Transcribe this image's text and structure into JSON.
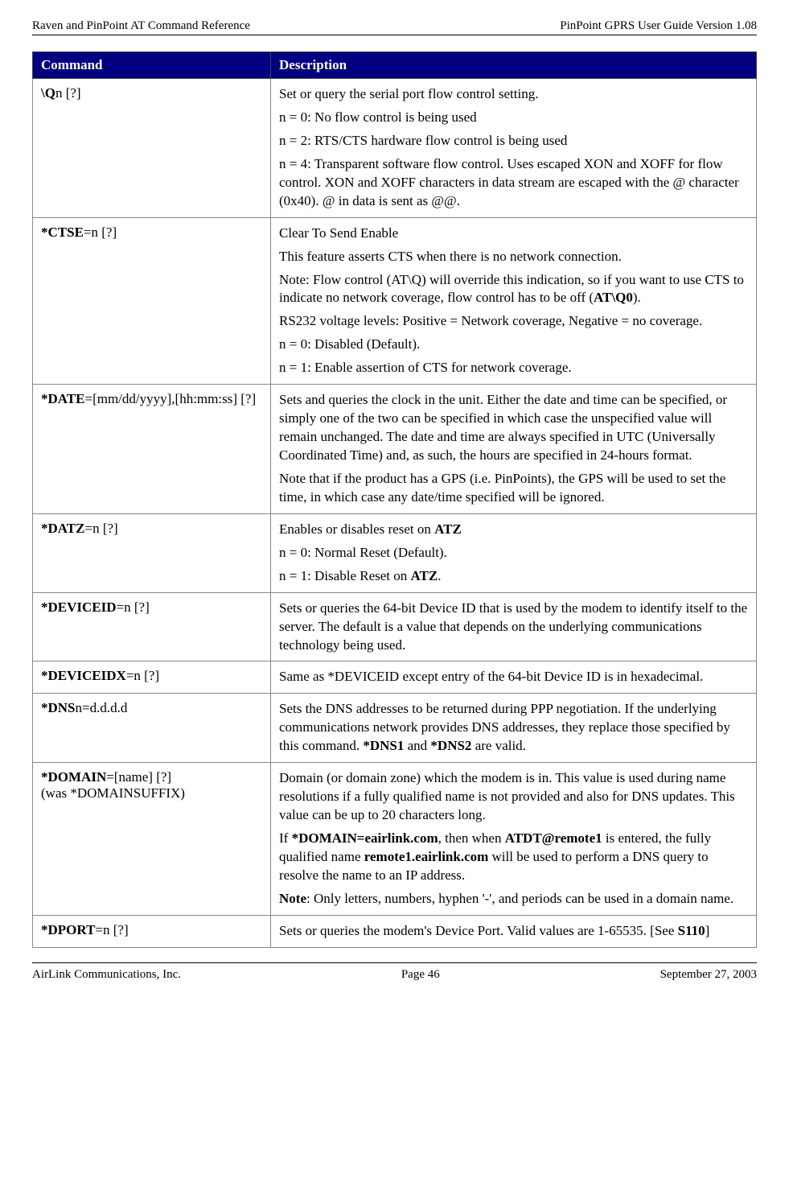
{
  "header": {
    "left": "Raven and PinPoint AT Command Reference",
    "right": "PinPoint GPRS User Guide Version 1.08"
  },
  "footer": {
    "left": "AirLink Communications, Inc.",
    "center": "Page 46",
    "right": "September 27, 2003"
  },
  "table": {
    "th1": "Command",
    "th2": "Description",
    "rows": {
      "q": {
        "cmd_pre": "\\Q",
        "cmd_post": "n [?]",
        "d1": "Set or query the serial port flow control setting.",
        "d2": "n = 0: No flow control is being used",
        "d3": "n = 2: RTS/CTS hardware flow control is being used",
        "d4": "n = 4: Transparent software flow control. Uses escaped XON and XOFF for flow control. XON and XOFF characters in data stream are escaped with the @ character (0x40). @ in data is sent as @@."
      },
      "ctse": {
        "cmd_pre": "*CTSE",
        "cmd_post": "=n [?]",
        "d1": "Clear To Send Enable",
        "d2": "This feature asserts CTS when there is no network connection.",
        "d3a": "Note: Flow control (AT\\Q) will override this indication, so if you want to use CTS to indicate no network coverage, flow control has to be off (",
        "d3b": "AT\\Q0",
        "d3c": ").",
        "d4": "RS232 voltage levels: Positive = Network coverage, Negative = no coverage.",
        "d5": "n = 0: Disabled (Default).",
        "d6": "n = 1: Enable assertion of CTS for network coverage."
      },
      "date": {
        "cmd_pre": "*DATE",
        "cmd_post": "=[mm/dd/yyyy],[hh:mm:ss] [?]",
        "d1": "Sets and queries the clock in the unit. Either the date and time can be specified, or simply one of the two can be specified in which case the unspecified value will remain unchanged. The date and time are always specified in UTC (Universally Coordinated Time) and, as such, the hours are specified in 24-hours format.",
        "d2": "Note that if the product has a GPS (i.e. PinPoints), the GPS will be used to set the time, in which case any date/time specified will be ignored."
      },
      "datz": {
        "cmd_pre": "*DATZ",
        "cmd_post": "=n [?]",
        "d1a": "Enables or disables reset on ",
        "d1b": "ATZ",
        "d2": "n = 0: Normal Reset (Default).",
        "d3a": "n = 1: Disable Reset on ",
        "d3b": "ATZ",
        "d3c": "."
      },
      "deviceid": {
        "cmd_pre": "*DEVICEID",
        "cmd_post": "=n [?]",
        "d1": "Sets or queries the 64-bit Device ID that is used by the modem to identify itself to the server. The default is a value that depends on the underlying communications technology being used."
      },
      "deviceidx": {
        "cmd_pre": "*DEVICEIDX",
        "cmd_post": "=n [?]",
        "d1": "Same as *DEVICEID except entry of the 64-bit Device ID is in hexadecimal."
      },
      "dns": {
        "cmd_pre": "*DNS",
        "cmd_post": "n=d.d.d.d",
        "d1a": "Sets the DNS addresses to be returned during PPP negotiation. If the underlying communications network provides DNS addresses, they replace those specified by this command. ",
        "d1b": "*DNS1",
        "d1c": " and ",
        "d1d": "*DNS2",
        "d1e": " are valid."
      },
      "domain": {
        "cmd_pre": "*DOMAIN",
        "cmd_post": "=[name] [?]",
        "cmd_line2": "(was *DOMAINSUFFIX)",
        "d1": "Domain (or domain zone) which the modem is in. This value is used during name resolutions if a fully qualified name is not provided and also for DNS updates. This value can be up to 20 characters long.",
        "d2a": "If ",
        "d2b": "*DOMAIN=eairlink.com",
        "d2c": ", then when ",
        "d2d": "ATDT@remote1",
        "d2e": " is entered, the fully qualified name ",
        "d2f": "remote1.eairlink.com",
        "d2g": " will be used to perform a DNS query to resolve the name to an IP address.",
        "d3a": "Note",
        "d3b": ": Only letters, numbers, hyphen '-', and periods can be used in a domain name."
      },
      "dport": {
        "cmd_pre": "*DPORT",
        "cmd_post": "=n [?]",
        "d1a": "Sets or queries the modem's Device Port. Valid values are 1-65535. [See ",
        "d1b": "S110",
        "d1c": "]"
      }
    }
  }
}
